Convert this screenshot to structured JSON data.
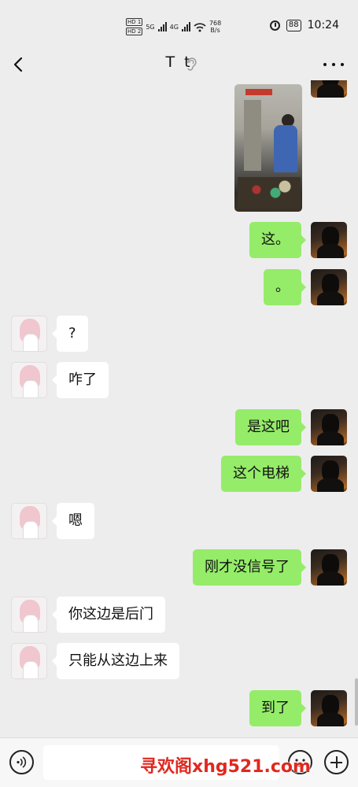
{
  "status_bar": {
    "hd1": "HD 1",
    "hd2": "HD 2",
    "net1": "5G",
    "net2": "4G",
    "speed_value": "768",
    "speed_unit": "B/s",
    "battery": "88",
    "time": "10:24"
  },
  "header": {
    "title": "T t"
  },
  "messages": [
    {
      "sender": "me",
      "text": "这。"
    },
    {
      "sender": "me",
      "text": "。"
    },
    {
      "sender": "other",
      "text": "?"
    },
    {
      "sender": "other",
      "text": "咋了"
    },
    {
      "sender": "me",
      "text": "是这吧"
    },
    {
      "sender": "me",
      "text": "这个电梯"
    },
    {
      "sender": "other",
      "text": "嗯"
    },
    {
      "sender": "me",
      "text": "刚才没信号了"
    },
    {
      "sender": "other",
      "text": "你这边是后门"
    },
    {
      "sender": "other",
      "text": "只能从这边上来"
    },
    {
      "sender": "me",
      "text": "到了"
    }
  ],
  "input": {
    "value": "",
    "placeholder": ""
  },
  "watermark": "寻欢阁xhg521.com",
  "colors": {
    "my_bubble": "#95ec69",
    "their_bubble": "#ffffff",
    "background": "#ededed"
  },
  "icons": [
    "back-icon",
    "ear-icon",
    "more-icon",
    "voice-icon",
    "emoji-icon",
    "plus-icon"
  ]
}
